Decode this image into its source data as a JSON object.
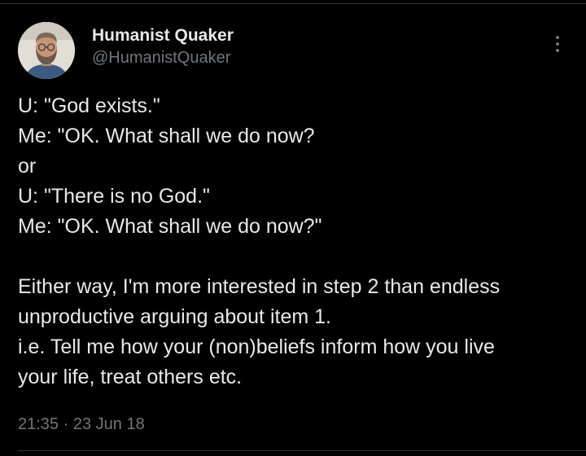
{
  "author": {
    "display_name": "Humanist Quaker",
    "handle": "@HumanistQuaker"
  },
  "icons": {
    "more": "more-options-icon",
    "avatar": "profile-photo"
  },
  "tweet": {
    "lines": [
      "U: \"God exists.\"",
      "Me: \"OK. What shall we do now?",
      "or",
      "U: \"There is no God.\"",
      "Me: \"OK. What shall we do now?\"",
      "",
      "Either way, I'm more interested in step 2 than endless",
      "unproductive arguing about item 1.",
      "i.e. Tell me how your (non)beliefs inform how you live",
      "your life, treat others etc."
    ],
    "time": "21:35",
    "separator": "·",
    "date": "23 Jun 18"
  },
  "colors": {
    "background": "#000000",
    "primary_text": "#e7e9ea",
    "secondary_text": "#71767b",
    "divider": "#2f3336"
  }
}
